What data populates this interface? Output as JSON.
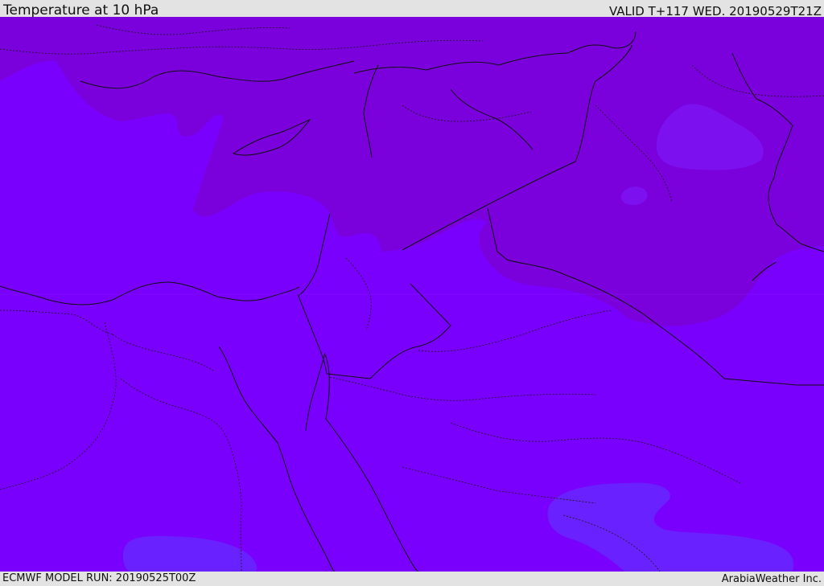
{
  "header": {
    "title": "Temperature at 10 hPa",
    "valid_time": "VALID T+117 WED. 20190529T21Z"
  },
  "footer": {
    "model_run": "ECMWF MODEL RUN: 20190525T00Z",
    "credit": "ArabiaWeather Inc."
  },
  "map": {
    "colors": {
      "base_field": "#7a00fe",
      "warm_field": "#7a00dc",
      "cool_field": "#6a21ff",
      "border_line": "#111111",
      "country_border": "#1a1a1a",
      "frame_bar": "#e3e3e3"
    }
  }
}
